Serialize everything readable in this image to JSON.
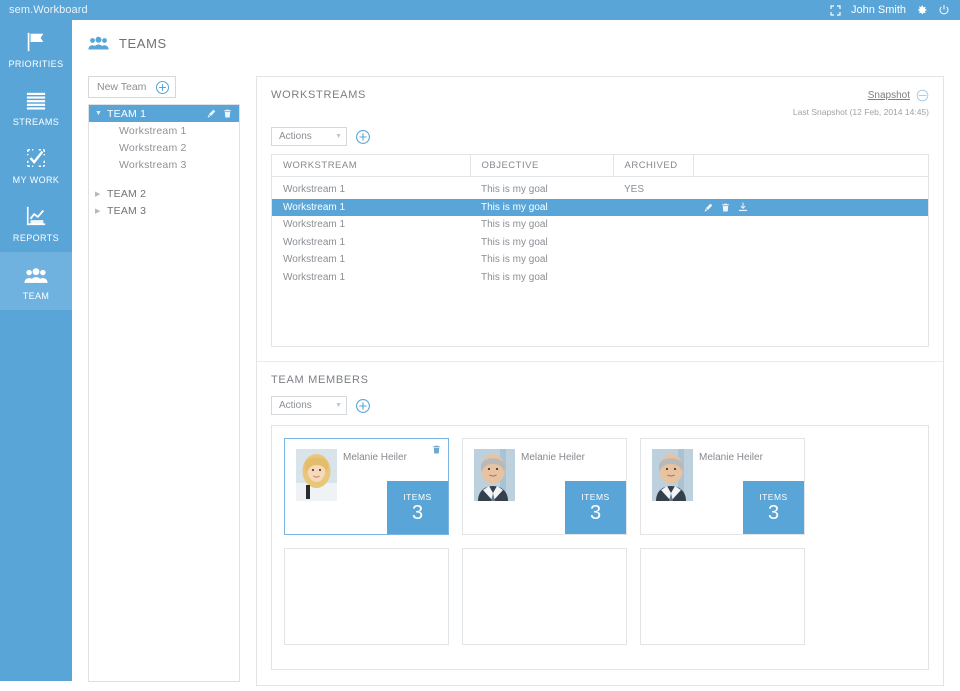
{
  "topbar": {
    "brand": "sem.Workboard",
    "user": "John Smith",
    "expand_icon": "expand-icon",
    "settings_icon": "gear-icon",
    "power_icon": "power-icon"
  },
  "sidebar": {
    "items": [
      {
        "label": "PRIORITIES",
        "icon": "flag-icon",
        "active": false
      },
      {
        "label": "STREAMS",
        "icon": "lines-icon",
        "active": false
      },
      {
        "label": "MY WORK",
        "icon": "checklist-icon",
        "active": false
      },
      {
        "label": "REPORTS",
        "icon": "chart-icon",
        "active": false
      },
      {
        "label": "TEAM",
        "icon": "people-icon",
        "active": true
      }
    ]
  },
  "page": {
    "title": "TEAMS",
    "title_icon": "people-icon"
  },
  "teams_panel": {
    "new_team_label": "New Team",
    "add_icon": "plus-circle-icon",
    "tree": [
      {
        "label": "TEAM 1",
        "expanded": true,
        "selected": true,
        "caret": "▼",
        "edit_icon": "pencil-icon",
        "delete_icon": "trash-icon",
        "children": [
          "Workstream 1",
          "Workstream 2",
          "Workstream 3"
        ]
      },
      {
        "label": "TEAM 2",
        "expanded": false,
        "selected": false,
        "caret": "▶",
        "children": []
      },
      {
        "label": "TEAM 3",
        "expanded": false,
        "selected": false,
        "caret": "▶",
        "children": []
      }
    ]
  },
  "workstreams": {
    "title": "WORKSTREAMS",
    "snapshot_link": "Snapshot",
    "snapshot_icon": "snapshot-circle-icon",
    "last_snapshot": "Last Snapshot (12 Feb, 2014 14:45)",
    "actions_label": "Actions",
    "add_icon": "plus-circle-icon",
    "columns": [
      "WORKSTREAM",
      "OBJECTIVE",
      "ARCHIVED",
      ""
    ],
    "rows": [
      {
        "workstream": "Workstream 1",
        "objective": "This is my goal",
        "archived": "YES",
        "selected": false
      },
      {
        "workstream": "Workstream 1",
        "objective": "This is my goal",
        "archived": "",
        "selected": true
      },
      {
        "workstream": "Workstream 1",
        "objective": "This is my goal",
        "archived": "",
        "selected": false
      },
      {
        "workstream": "Workstream 1",
        "objective": "This is my goal",
        "archived": "",
        "selected": false
      },
      {
        "workstream": "Workstream 1",
        "objective": "This is my goal",
        "archived": "",
        "selected": false
      },
      {
        "workstream": "Workstream 1",
        "objective": "This is my goal",
        "archived": "",
        "selected": false
      }
    ],
    "row_action_icons": [
      "pencil-icon",
      "trash-icon",
      "download-icon"
    ]
  },
  "team_members": {
    "title": "TEAM MEMBERS",
    "actions_label": "Actions",
    "add_icon": "plus-circle-icon",
    "items_label": "ITEMS",
    "cards": [
      {
        "name": "Melanie Heiler",
        "items": "3",
        "selected": true,
        "photo": "blonde-woman",
        "delete_icon": "trash-icon"
      },
      {
        "name": "Melanie Heiler",
        "items": "3",
        "selected": false,
        "photo": "grey-man",
        "delete_icon": ""
      },
      {
        "name": "Melanie Heiler",
        "items": "3",
        "selected": false,
        "photo": "grey-man",
        "delete_icon": ""
      },
      {
        "name": "",
        "items": "",
        "selected": false,
        "photo": "",
        "delete_icon": ""
      },
      {
        "name": "",
        "items": "",
        "selected": false,
        "photo": "",
        "delete_icon": ""
      },
      {
        "name": "",
        "items": "",
        "selected": false,
        "photo": "",
        "delete_icon": ""
      }
    ]
  },
  "colors": {
    "brand_blue": "#5aa5d8",
    "brand_blue_active": "#6fb2e0",
    "border": "#e2e5e8",
    "text_grey": "#8b8f94"
  }
}
